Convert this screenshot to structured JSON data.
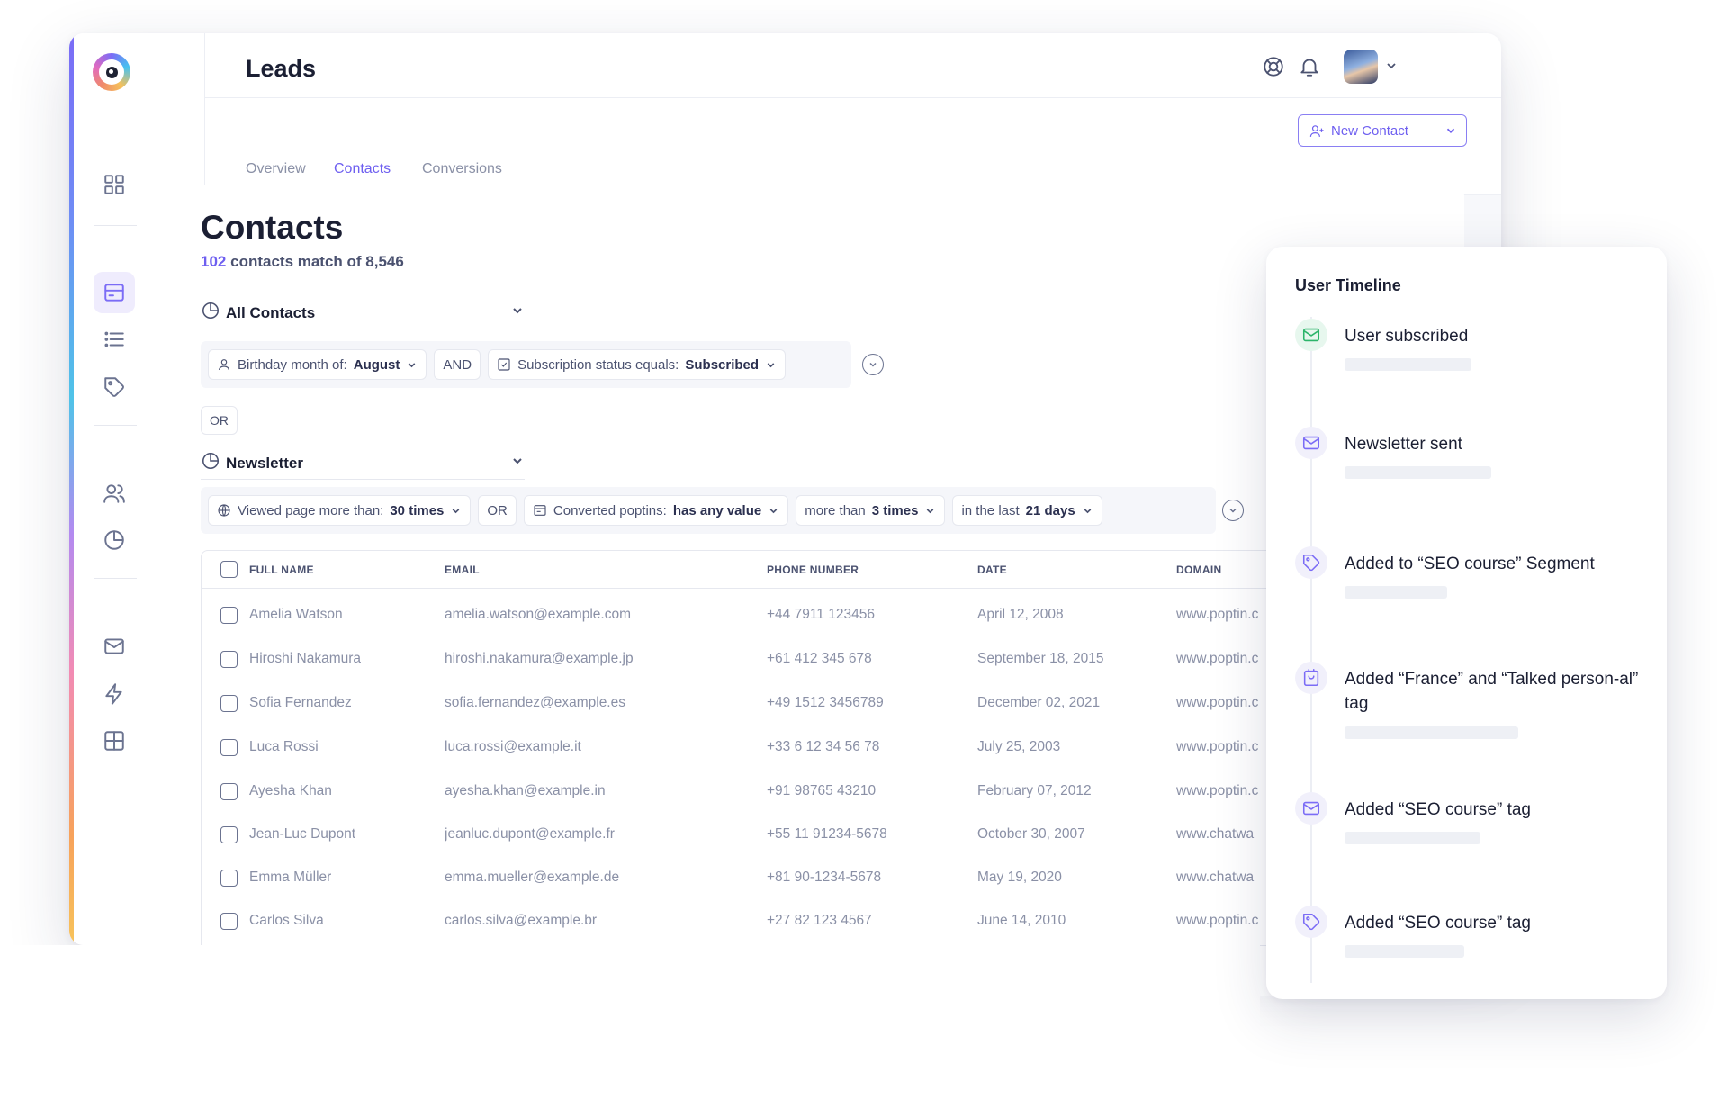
{
  "header": {
    "title": "Leads",
    "tabs": [
      "Overview",
      "Contacts",
      "Conversions"
    ],
    "new_contact_label": "New Contact"
  },
  "sidebar": {
    "icons": [
      "grid-icon",
      "inbox-icon",
      "list-icon",
      "tag-icon",
      "users-icon",
      "pie-chart-icon",
      "mail-icon",
      "lightning-icon",
      "layout-icon"
    ]
  },
  "contacts": {
    "title": "Contacts",
    "match_count": "102",
    "match_text": "contacts match of 8,546"
  },
  "segments": [
    {
      "name": "All Contacts",
      "filters": [
        {
          "prefix": "Birthday month of:",
          "value": "August"
        },
        {
          "connector": "AND"
        },
        {
          "prefix": "Subscription status equals:",
          "value": "Subscribed"
        }
      ]
    },
    {
      "name": "Newsletter",
      "filters": [
        {
          "prefix": "Viewed page more than:",
          "value": "30 times"
        },
        {
          "connector": "OR"
        },
        {
          "prefix": "Converted poptins:",
          "value": "has any value"
        },
        {
          "prefix": "more than",
          "value": "3 times"
        },
        {
          "prefix": "in the last",
          "value": "21 days"
        }
      ]
    }
  ],
  "segment_connector": "OR",
  "table": {
    "columns": [
      "FULL NAME",
      "EMAIL",
      "PHONE NUMBER",
      "DATE",
      "DOMAIN"
    ],
    "rows": [
      {
        "name": "Amelia Watson",
        "email": "amelia.watson@example.com",
        "phone": "+44 7911 123456",
        "date": "April 12, 2008",
        "domain": "www.poptin.c"
      },
      {
        "name": "Hiroshi Nakamura",
        "email": "hiroshi.nakamura@example.jp",
        "phone": "+61 412 345 678",
        "date": "September 18, 2015",
        "domain": "www.poptin.c"
      },
      {
        "name": "Sofia Fernandez",
        "email": "sofia.fernandez@example.es",
        "phone": "+49 1512 3456789",
        "date": "December 02, 2021",
        "domain": "www.poptin.c"
      },
      {
        "name": "Luca Rossi",
        "email": "luca.rossi@example.it",
        "phone": "+33 6 12 34 56 78",
        "date": "July 25, 2003",
        "domain": "www.poptin.c"
      },
      {
        "name": "Ayesha Khan",
        "email": "ayesha.khan@example.in",
        "phone": "+91 98765 43210",
        "date": "February 07, 2012",
        "domain": "www.poptin.c"
      },
      {
        "name": "Jean-Luc Dupont",
        "email": "jeanluc.dupont@example.fr",
        "phone": "+55 11 91234-5678",
        "date": "October 30, 2007",
        "domain": "www.chatwa"
      },
      {
        "name": "Emma Müller",
        "email": "emma.mueller@example.de",
        "phone": "+81 90-1234-5678",
        "date": "May 19, 2020",
        "domain": "www.chatwa"
      },
      {
        "name": "Carlos Silva",
        "email": "carlos.silva@example.br",
        "phone": "+27 82 123 4567",
        "date": "June 14, 2010",
        "domain": "www.poptin.c"
      }
    ]
  },
  "timeline": {
    "title": "User Timeline",
    "events": [
      {
        "text": "User subscribed",
        "icon": "mail-icon",
        "tone": "green"
      },
      {
        "text": "Newsletter sent",
        "icon": "mail-icon",
        "tone": "purple"
      },
      {
        "text": "Added to “SEO course” Segment",
        "icon": "tag-icon",
        "tone": "purple"
      },
      {
        "text": "Added “France” and “Talked person-al” tag",
        "icon": "calendar-tag-icon",
        "tone": "purple"
      },
      {
        "text": "Added “SEO course” tag",
        "icon": "mail-icon",
        "tone": "purple"
      },
      {
        "text": "Added “SEO course” tag",
        "icon": "tag-icon",
        "tone": "purple"
      }
    ]
  },
  "colors": {
    "accent": "#6e5ff0",
    "success": "#2cb56a",
    "text": "#1b1f33",
    "muted": "#8a90a6"
  }
}
